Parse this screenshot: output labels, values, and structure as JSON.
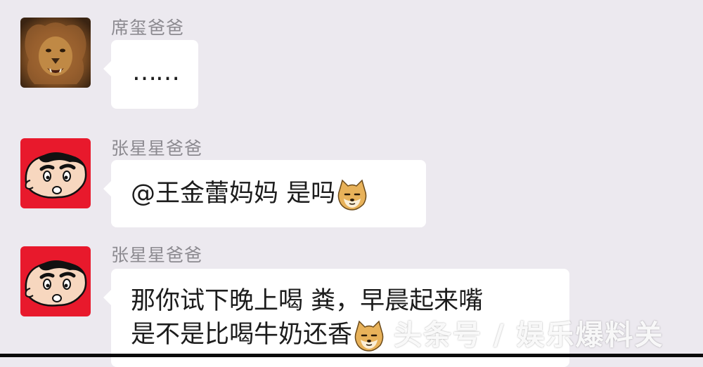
{
  "messages": [
    {
      "sender": "席玺爸爸",
      "avatar": "lion-avatar",
      "text": "……",
      "emoji": null
    },
    {
      "sender": "张星星爸爸",
      "avatar": "crayon-shin-chan-avatar",
      "text": "@王金蕾妈妈 是吗",
      "emoji": "doge-emoji"
    },
    {
      "sender": "张星星爸爸",
      "avatar": "crayon-shin-chan-avatar",
      "line1": "那你试下晚上喝 粪，早晨起来嘴",
      "line2": "是不是比喝牛奶还香",
      "emoji": "doge-emoji"
    }
  ],
  "watermark": "头条号 / 娱乐爆料关",
  "colors": {
    "background": "#ece9ef",
    "bubble": "#ffffff",
    "sender": "#8c8a90",
    "shin_chan_bg": "#e8192c"
  }
}
